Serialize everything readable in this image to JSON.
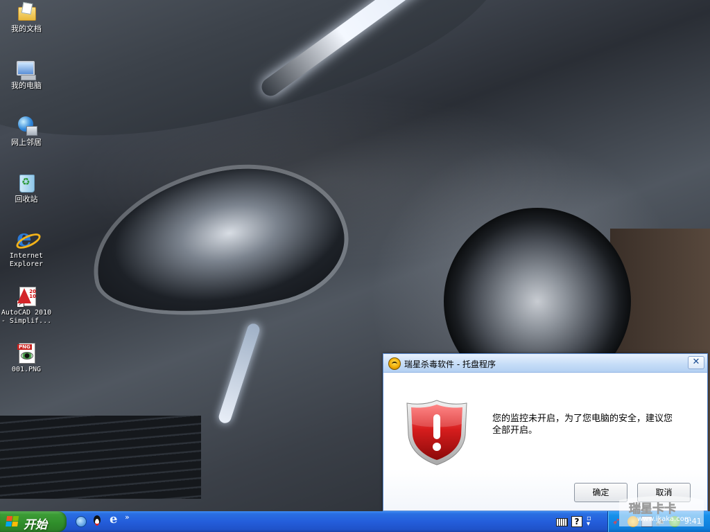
{
  "desktop": {
    "icons": [
      {
        "label": "我的文档",
        "icon": "my-documents-icon"
      },
      {
        "label": "我的电脑",
        "icon": "my-computer-icon"
      },
      {
        "label": "网上邻居",
        "icon": "network-places-icon"
      },
      {
        "label": "回收站",
        "icon": "recycle-bin-icon"
      },
      {
        "label_line1": "Internet",
        "label_line2": "Explorer",
        "icon": "internet-explorer-icon"
      },
      {
        "label_line1": "AutoCAD 2010",
        "label_line2": "- Simplif...",
        "badge": "20\n10",
        "icon": "autocad-icon"
      },
      {
        "label": "001.PNG",
        "tag": "PNG",
        "icon": "png-file-icon"
      }
    ]
  },
  "dialog": {
    "title": "瑞星杀毒软件 - 托盘程序",
    "close_glyph": "✕",
    "message": "您的监控未开启，为了您电脑的安全，建议您全部开启。",
    "ok_label": "确定",
    "cancel_label": "取消",
    "accent": "#d01818"
  },
  "taskbar": {
    "start_label": "开始",
    "more_glyph": "»",
    "help_glyph": "?",
    "clock": "9:41",
    "colors": {
      "taskbar": "#245edb",
      "start": "#3c9c36",
      "tray": "#1790ea"
    }
  },
  "watermark": {
    "text": "瑞星卡卡",
    "url": "www.ikaka.com"
  }
}
